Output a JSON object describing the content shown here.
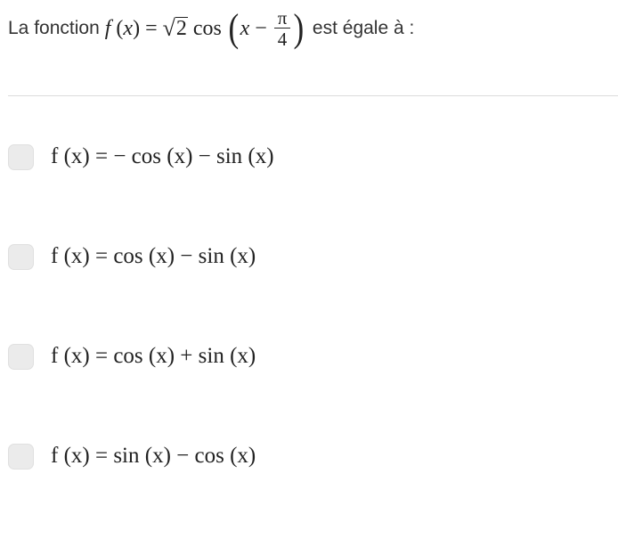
{
  "question": {
    "prefix": "La fonction",
    "suffix": "est égale à :",
    "formula": {
      "func": "f",
      "var": "x",
      "coef_symbol": "√",
      "coef_value": "2",
      "trig": "cos",
      "frac_num": "π",
      "frac_den": "4"
    }
  },
  "options": [
    {
      "lhs": "f (x) =",
      "rhs": "− cos (x) − sin (x)"
    },
    {
      "lhs": "f (x) =",
      "rhs": "cos (x) − sin (x)"
    },
    {
      "lhs": "f (x) =",
      "rhs": "cos (x) + sin (x)"
    },
    {
      "lhs": "f (x) =",
      "rhs": "sin (x) − cos (x)"
    }
  ]
}
